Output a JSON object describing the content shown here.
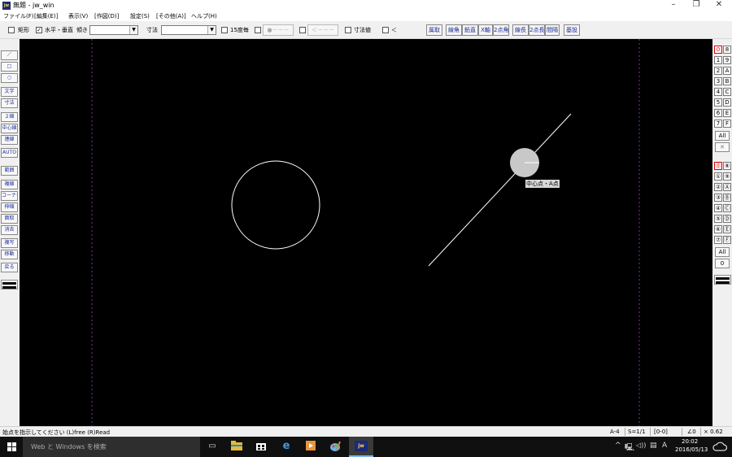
{
  "window": {
    "app_icon_text": "jw",
    "title": "無題 - jw_win",
    "minimize": "–",
    "restore": "❐",
    "close": "✕"
  },
  "menu": [
    "ファイル(F)",
    "[編集(E)]",
    "表示(V)",
    "[作図(D)]",
    "設定(S)",
    "[その他(A)]",
    "ヘルプ(H)"
  ],
  "options": {
    "rect_label": "矩形",
    "hv_checked": "✓",
    "hv_label": "水平・垂直",
    "angle_label": "傾き",
    "dim_label": "寸法",
    "deg15_label": "15度毎",
    "btn_dot_line": "●－－－",
    "btn_arrow_line": "＜－－－",
    "dimvalue_label": "寸法値",
    "lt_label": "＜",
    "buttons": [
      "属取",
      "線角",
      "鉛直",
      "X軸",
      "2点角",
      "線長",
      "2点長",
      "間隔",
      "基設"
    ]
  },
  "left_tools": [
    "／",
    "□",
    "○",
    "文字",
    "寸法",
    "２線",
    "中心線",
    "連線",
    "AUTO",
    "範囲",
    "複線",
    "コーナー",
    "伸縮",
    "面取",
    "消去",
    "複写",
    "移動",
    "戻る"
  ],
  "right_layers": {
    "group_a": [
      [
        "0",
        "8"
      ],
      [
        "1",
        "9"
      ],
      [
        "2",
        "A"
      ],
      [
        "3",
        "B"
      ],
      [
        "4",
        "C"
      ],
      [
        "5",
        "D"
      ],
      [
        "6",
        "E"
      ],
      [
        "7",
        "F"
      ]
    ],
    "all_a": "All",
    "x_a": "✕",
    "group_b": [
      [
        "⓪",
        "⑧"
      ],
      [
        "①",
        "⑨"
      ],
      [
        "②",
        "Ⓐ"
      ],
      [
        "③",
        "Ⓑ"
      ],
      [
        "④",
        "Ⓒ"
      ],
      [
        "⑤",
        "Ⓓ"
      ],
      [
        "⑥",
        "Ⓔ"
      ],
      [
        "⑦",
        "Ⓕ"
      ]
    ],
    "all_b": "All",
    "zero_b": "0"
  },
  "canvas": {
    "tooltip": "中心点・A点",
    "colors": {
      "background": "#000000",
      "line": "#ffffff",
      "guide": "#7f2fa8",
      "marker": "#c8c8c8"
    }
  },
  "status": {
    "message": "始点を指示してください (L)free (R)Read",
    "paper": "A-4",
    "scale": "S=1/1",
    "layer": "[0-0]",
    "angle": "∠0",
    "zoom": "× 0.62"
  },
  "taskbar": {
    "start_icon": "windows-logo",
    "search_placeholder": "Web と Windows を検索",
    "tray_caret": "^",
    "tray_network": "🖳",
    "tray_volume": "◁))",
    "tray_message": "▤",
    "ime": "A",
    "time": "20:02",
    "date": "2016/05/13"
  }
}
